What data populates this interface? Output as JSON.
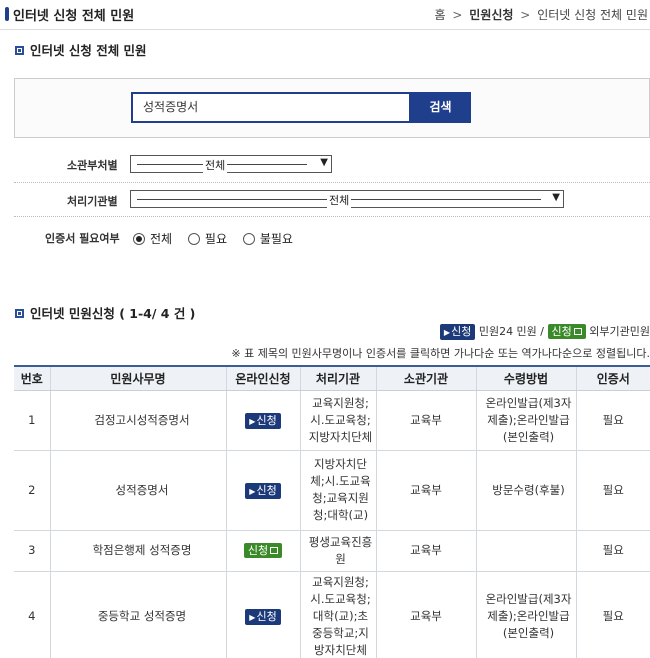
{
  "header": {
    "title": "인터넷 신청 전체 민원",
    "breadcrumb": {
      "home": "홈",
      "sep": ">",
      "level1": "민원신청",
      "level2": "인터넷 신청 전체 민원"
    }
  },
  "search_section": {
    "heading": "인터넷 신청 전체 민원",
    "query": "성적증명서",
    "button_label": "검색"
  },
  "filters": {
    "dept_label": "소관부처별",
    "dept_value": "전체",
    "agency_label": "처리기관별",
    "agency_value": "전체",
    "cert_label": "인증서 필요여부",
    "cert_options": [
      "전체",
      "필요",
      "불필요"
    ],
    "cert_selected": "전체"
  },
  "results": {
    "heading": "인터넷 민원신청 ( 1-4/ 4 건 )",
    "legend": {
      "blue_badge": "신청",
      "blue_text": "민원24 민원 /",
      "green_badge": "신청",
      "green_text": "외부기관민원"
    },
    "note": "※ 표 제목의 민원사무명이나 인증서를 클릭하면 가나다순 또는 역가나다순으로 정렬됩니다.",
    "columns": [
      "번호",
      "민원사무명",
      "온라인신청",
      "처리기관",
      "소관기관",
      "수령방법",
      "인증서"
    ],
    "rows": [
      {
        "no": "1",
        "name": "검정고시성적증명서",
        "apply": "신청",
        "apply_type": "blue",
        "proc": "교육지원청;\n시.도교육청;\n지방자치단체",
        "dept": "교육부",
        "method": "온라인발급(제3자\n제출);온라인발급\n(본인출력)",
        "cert": "필요"
      },
      {
        "no": "2",
        "name": "성적증명서",
        "apply": "신청",
        "apply_type": "blue",
        "proc": "지방자치단\n체;시.도교육\n청;교육지원\n청;대학(교)",
        "dept": "교육부",
        "method": "방문수령(후불)",
        "cert": "필요"
      },
      {
        "no": "3",
        "name": "학점은행제 성적증명",
        "apply": "신청",
        "apply_type": "green",
        "proc": "평생교육진흥\n원",
        "dept": "교육부",
        "method": "",
        "cert": "필요"
      },
      {
        "no": "4",
        "name": "중등학교 성적증명",
        "apply": "신청",
        "apply_type": "blue",
        "proc": "교육지원청;\n시.도교육청;\n대학(교);초\n중등학교;지\n방자치단체",
        "dept": "교육부",
        "method": "온라인발급(제3자\n제출);온라인발급\n(본인출력)",
        "cert": "필요"
      }
    ]
  }
}
